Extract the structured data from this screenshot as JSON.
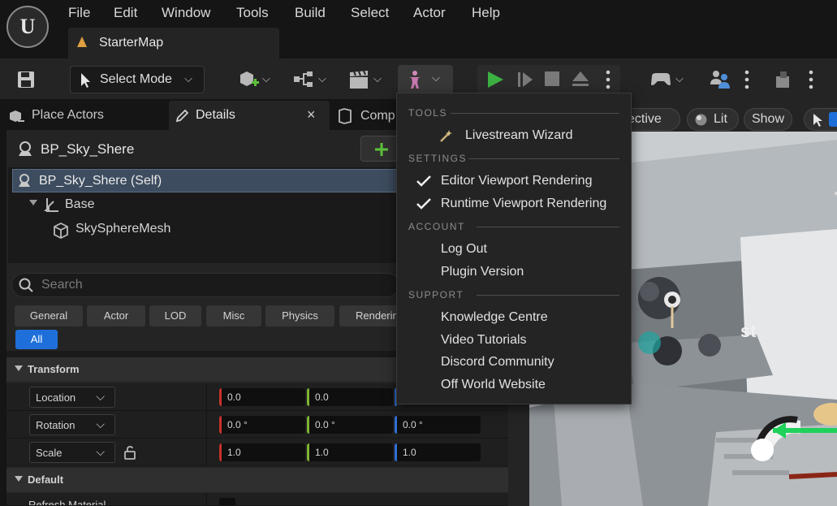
{
  "menubar": {
    "logo_text": "U",
    "items": [
      "File",
      "Edit",
      "Window",
      "Tools",
      "Build",
      "Select",
      "Actor",
      "Help"
    ],
    "map_tab": "StarterMap"
  },
  "toolbar": {
    "select_mode": "Select Mode"
  },
  "panel_tabs": {
    "place_actors": "Place Actors",
    "details": "Details",
    "components": "Comp",
    "close": "×"
  },
  "details": {
    "actor_name": "BP_Sky_Shere",
    "add_button": "+ A",
    "tree": [
      {
        "label": "BP_Sky_Shere (Self)"
      },
      {
        "label": "Base"
      },
      {
        "label": "SkySphereMesh"
      }
    ],
    "search_placeholder": "Search",
    "categories": [
      "General",
      "Actor",
      "LOD",
      "Misc",
      "Physics",
      "Renderin"
    ],
    "all": "All",
    "sections": {
      "transform": "Transform",
      "default": "Default"
    },
    "rows": [
      {
        "label": "Location",
        "x": "0.0",
        "y": "0.0",
        "z": ""
      },
      {
        "label": "Rotation",
        "x": "0.0 °",
        "y": "0.0 °",
        "z": "0.0 °"
      },
      {
        "label": "Scale",
        "x": "1.0",
        "y": "1.0",
        "z": "1.0"
      }
    ],
    "partial_row": "Refresh Material"
  },
  "viewport": {
    "perspective": "ective",
    "lit": "Lit",
    "show": "Show"
  },
  "dropdown": {
    "tools_header": "TOOLS",
    "livestream": "Livestream Wizard",
    "settings_header": "SETTINGS",
    "editor_rendering": "Editor Viewport Rendering",
    "runtime_rendering": "Runtime Viewport Rendering",
    "account_header": "ACCOUNT",
    "log_out": "Log Out",
    "plugin_version": "Plugin Version",
    "support_header": "SUPPORT",
    "knowledge": "Knowledge Centre",
    "video": "Video Tutorials",
    "discord": "Discord Community",
    "website": "Off World Website"
  },
  "colors": {
    "accent_blue": "#1e6fd9",
    "axis_x": "#c8312b",
    "axis_y": "#7fb331",
    "axis_z": "#2f6fd6",
    "play_green": "#3cb041"
  }
}
